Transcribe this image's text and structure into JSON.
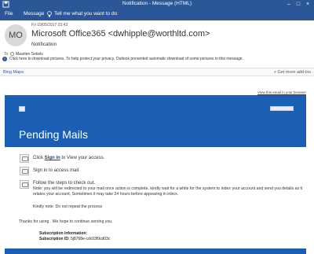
{
  "window": {
    "title": "Notification - Message (HTML)"
  },
  "ribbon": {
    "tabs": [
      "File",
      "Message"
    ],
    "tell_me": "Tell me what you want to do"
  },
  "header": {
    "avatar_initials": "MO",
    "date": "Fri 19/05/2017 03:43",
    "sender": "Microsoft Office365 <dwhipple@worthltd.com>",
    "subject": "Notification",
    "to_label": "To",
    "to_name": "Maarten Sekels",
    "info_text": "Click here to download pictures. To help protect your privacy, Outlook prevented automatic download of some pictures in this message."
  },
  "addin": {
    "bing": "Bing Maps",
    "get_more": "+ Get more add-ins"
  },
  "email": {
    "view_in_browser": "View this email in your browser",
    "heading": "Pending Mails",
    "step1_pre": "Click ",
    "step1_link": "Sign in",
    "step1_post": " to View your access.",
    "step2": "Sign in to access mail.",
    "step3": "Follow the steps to check out.",
    "note": "Note: you will be redirected to your mail once action is complete, kindly wait for a while for the system to index your account and send you details as it relates your account, Sometimes it may take 24 hours before appearing in inbox.",
    "kindly": "Kindly note: Do not repeat the process",
    "thanks": "Thanks for using . We hope to continue serving you.",
    "sub_info_label": "Subscription information:",
    "sub_id_label": "Subscription ID: ",
    "sub_id_value": "5j8768e-cdc03f9cd03c"
  },
  "colors": {
    "accent": "#2b579a",
    "banner": "#1a5fb4"
  }
}
